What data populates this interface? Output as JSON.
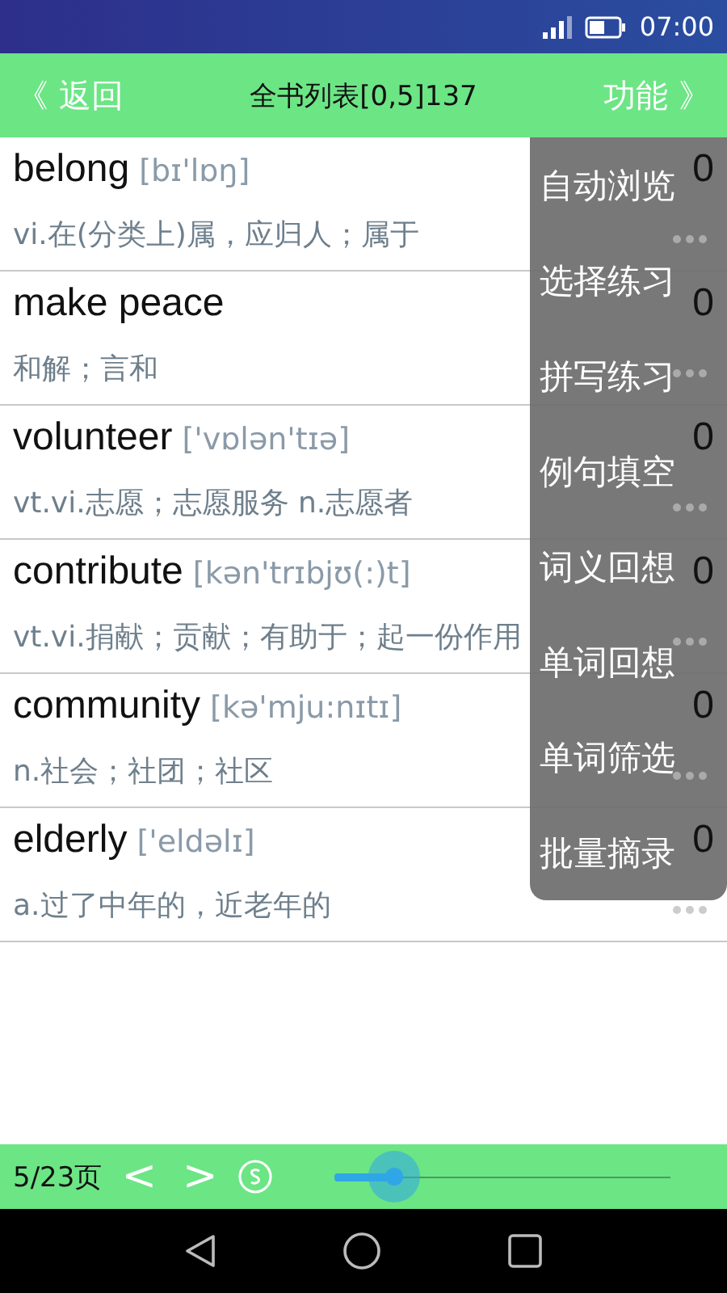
{
  "status_bar": {
    "time": "07:00"
  },
  "header": {
    "back": "《 返回",
    "title": "全书列表[0,5]137",
    "menu": "功能 》"
  },
  "words": [
    {
      "word": "belong",
      "phonetic": "[bɪ'lɒŋ]",
      "meaning": "vi.在(分类上)属，应归人；属于",
      "count": "0"
    },
    {
      "word": "make peace",
      "meaning": "和解；言和",
      "count": "0"
    },
    {
      "word": "volunteer",
      "phonetic": "['vɒlən'tɪə]",
      "meaning": "vt.vi.志愿；志愿服务 n.志愿者",
      "count": "0"
    },
    {
      "word": "contribute",
      "phonetic": "[kən'trɪbjʊ(:)t]",
      "meaning": "vt.vi.捐献；贡献；有助于；起一份作用",
      "count": "0"
    },
    {
      "word": "community",
      "phonetic": "[kə'mju:nɪtɪ]",
      "meaning": "n.社会；社团；社区",
      "count": "0"
    },
    {
      "word": "elderly",
      "phonetic": "['eldəlɪ]",
      "meaning": "a.过了中年的，近老年的",
      "count": "0"
    }
  ],
  "menu": [
    "自动浏览",
    "选择练习",
    "拼写练习",
    "例句填空",
    "词义回想",
    "单词回想",
    "单词筛选",
    "批量摘录"
  ],
  "footer": {
    "page": "5/23页",
    "prev": "<",
    "next": ">",
    "level": 0.18
  }
}
